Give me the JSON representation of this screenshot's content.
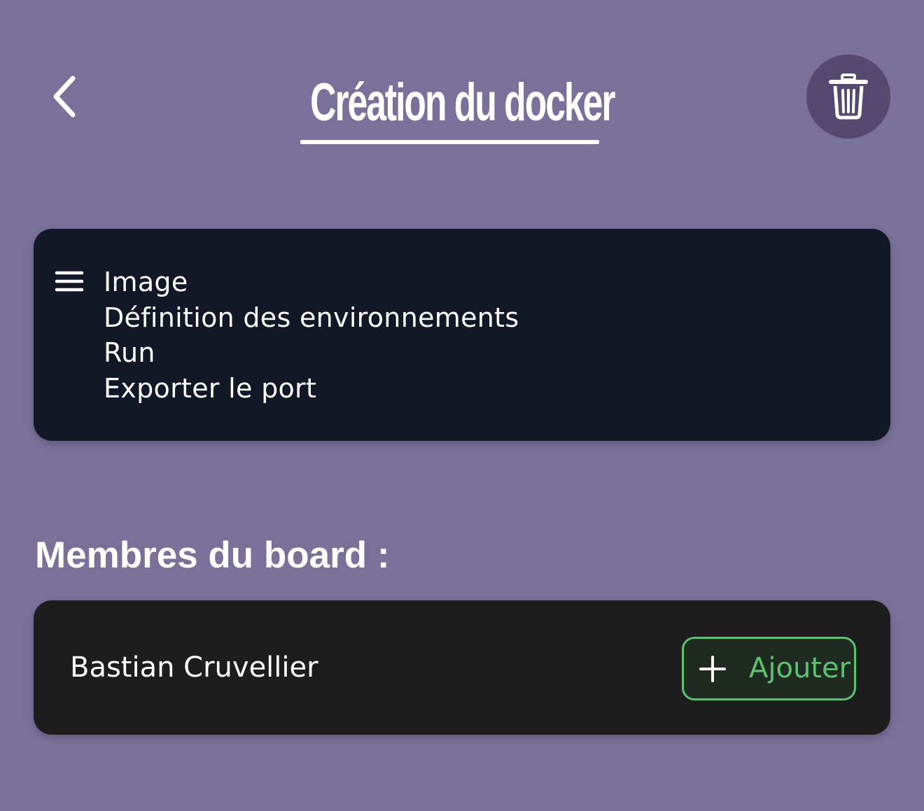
{
  "header": {
    "back_icon": "chevron-left-icon",
    "title": "Création du docker",
    "delete_icon": "trash-icon"
  },
  "steps_card": {
    "icon": "menu-icon",
    "items": [
      "Image",
      "Définition des environnements",
      "Run",
      "Exporter le port"
    ]
  },
  "members": {
    "section_title": "Membres du board :",
    "member_name": "Bastian Cruvellier",
    "add_icon": "plus-icon",
    "add_label": "Ajouter"
  },
  "colors": {
    "background": "#7a7099",
    "trash_button": "#56496f",
    "steps_card": "#131827",
    "members_card": "#1d1d1e",
    "accent_green": "#5bc46e",
    "text": "#ffffff"
  }
}
